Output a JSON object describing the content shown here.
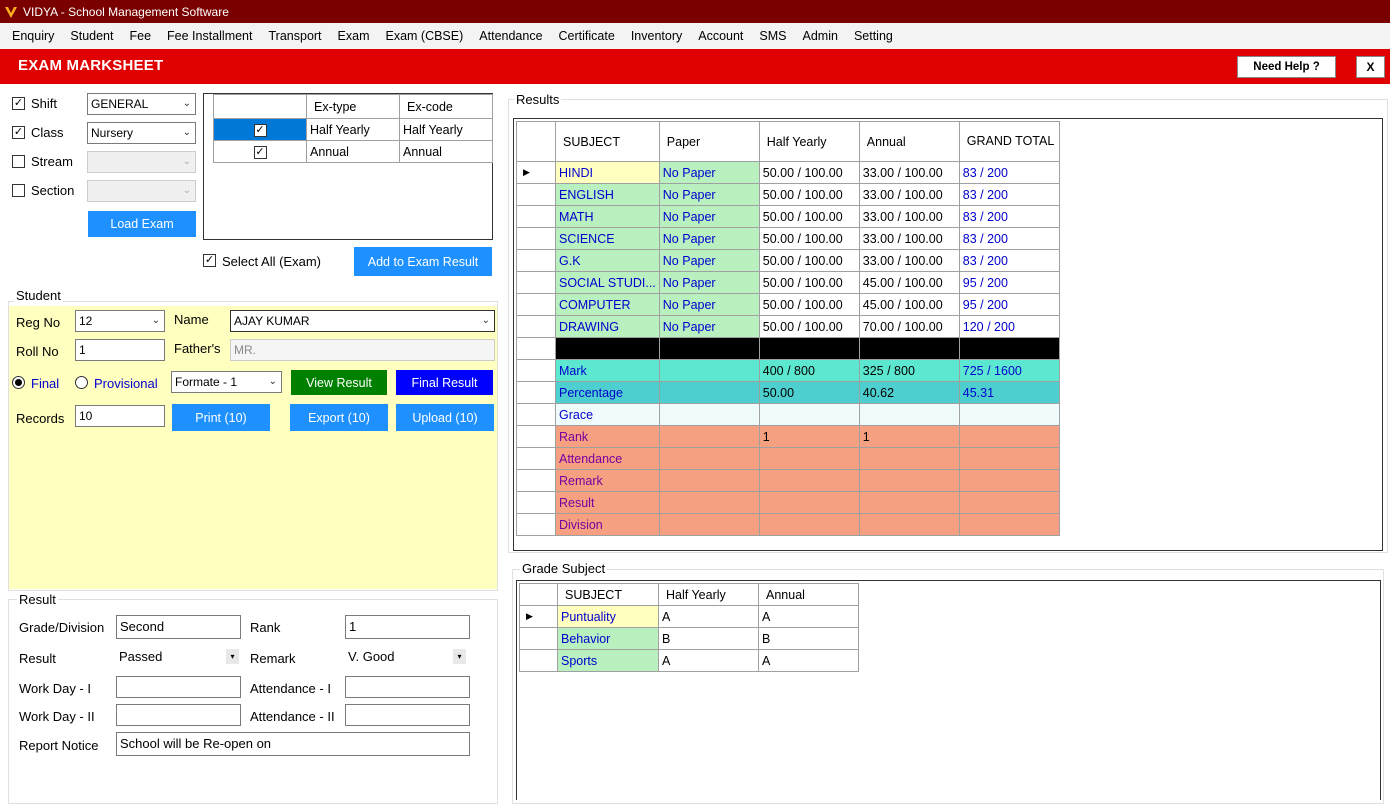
{
  "app": {
    "title": "VIDYA - School Management Software"
  },
  "menu": [
    "Enquiry",
    "Student",
    "Fee",
    "Fee Installment",
    "Transport",
    "Exam",
    "Exam (CBSE)",
    "Attendance",
    "Certificate",
    "Inventory",
    "Account",
    "SMS",
    "Admin",
    "Setting"
  ],
  "header": {
    "title": "EXAM MARKSHEET",
    "help_label": "Need Help ?",
    "close_label": "X"
  },
  "filters": {
    "shift": {
      "label": "Shift",
      "checked": true,
      "value": "GENERAL"
    },
    "class": {
      "label": "Class",
      "checked": true,
      "value": "Nursery"
    },
    "stream": {
      "label": "Stream",
      "checked": false,
      "value": ""
    },
    "section": {
      "label": "Section",
      "checked": false,
      "value": ""
    },
    "load_exam_label": "Load Exam"
  },
  "exam_grid": {
    "headers": [
      "Ex-type",
      "Ex-code"
    ],
    "rows": [
      {
        "checked": true,
        "type": "Half Yearly",
        "code": "Half Yearly",
        "selected": true
      },
      {
        "checked": true,
        "type": "Annual",
        "code": "Annual",
        "selected": false
      }
    ]
  },
  "select_all_label": "Select All (Exam)",
  "add_result_label": "Add to Exam Result",
  "student": {
    "title": "Student",
    "reg_no_label": "Reg No",
    "reg_no": "12",
    "name_label": "Name",
    "name": "AJAY KUMAR",
    "roll_no_label": "Roll No",
    "roll_no": "1",
    "father_label": "Father's",
    "father": "MR.",
    "final_label": "Final",
    "provisional_label": "Provisional",
    "format": "Formate - 1",
    "view_result_label": "View Result",
    "final_result_label": "Final Result",
    "records_label": "Records",
    "records": "10",
    "print_label": "Print (10)",
    "export_label": "Export (10)",
    "upload_label": "Upload (10)"
  },
  "result": {
    "title": "Result",
    "grade_label": "Grade/Division",
    "grade": "Second",
    "rank_label": "Rank",
    "rank": "1",
    "result_label": "Result",
    "result": "Passed",
    "remark_label": "Remark",
    "remark": "V. Good",
    "workday1_label": "Work Day - I",
    "workday1": "",
    "att1_label": "Attendance - I",
    "att1": "",
    "workday2_label": "Work Day - II",
    "workday2": "",
    "att2_label": "Attendance - II",
    "att2": "",
    "notice_label": "Report Notice",
    "notice": "School will be Re-open on"
  },
  "results": {
    "title": "Results",
    "headers": [
      "SUBJECT",
      "Paper",
      "Half Yearly",
      "Annual",
      "GRAND TOTAL"
    ],
    "subjects": [
      {
        "subject": "HINDI",
        "paper": "No Paper",
        "hy": "50.00 / 100.00",
        "an": "33.00 / 100.00",
        "total": "83 / 200"
      },
      {
        "subject": "ENGLISH",
        "paper": "No Paper",
        "hy": "50.00 / 100.00",
        "an": "33.00 / 100.00",
        "total": "83 / 200"
      },
      {
        "subject": "MATH",
        "paper": "No Paper",
        "hy": "50.00 / 100.00",
        "an": "33.00 / 100.00",
        "total": "83 / 200"
      },
      {
        "subject": "SCIENCE",
        "paper": "No Paper",
        "hy": "50.00 / 100.00",
        "an": "33.00 / 100.00",
        "total": "83 / 200"
      },
      {
        "subject": "G.K",
        "paper": "No Paper",
        "hy": "50.00 / 100.00",
        "an": "33.00 / 100.00",
        "total": "83 / 200"
      },
      {
        "subject": "SOCIAL STUDI...",
        "paper": "No Paper",
        "hy": "50.00 / 100.00",
        "an": "45.00 / 100.00",
        "total": "95 / 200"
      },
      {
        "subject": "COMPUTER",
        "paper": "No Paper",
        "hy": "50.00 / 100.00",
        "an": "45.00 / 100.00",
        "total": "95 / 200"
      },
      {
        "subject": "DRAWING",
        "paper": "No Paper",
        "hy": "50.00 / 100.00",
        "an": "70.00 / 100.00",
        "total": "120 / 200"
      }
    ],
    "mark": {
      "label": "Mark",
      "hy": "400 / 800",
      "an": "325 / 800",
      "total": "725 / 1600"
    },
    "percentage": {
      "label": "Percentage",
      "hy": "50.00",
      "an": "40.62",
      "total": "45.31"
    },
    "grace": {
      "label": "Grace"
    },
    "rank": {
      "label": "Rank",
      "hy": "1",
      "an": "1"
    },
    "attendance": {
      "label": "Attendance"
    },
    "remark": {
      "label": "Remark"
    },
    "result": {
      "label": "Result"
    },
    "division": {
      "label": "Division"
    }
  },
  "grade_subject": {
    "title": "Grade Subject",
    "headers": [
      "SUBJECT",
      "Half Yearly",
      "Annual"
    ],
    "rows": [
      {
        "subject": "Puntuality",
        "hy": "A",
        "an": "A"
      },
      {
        "subject": "Behavior",
        "hy": "B",
        "an": "B"
      },
      {
        "subject": "Sports",
        "hy": "A",
        "an": "A"
      }
    ]
  },
  "colors": {
    "titlebar": "#7a0000",
    "header": "#e00000",
    "subject_bg": "#b8f0c0",
    "mark_bg": "#5ce8d0",
    "percent_bg": "#4dcfcf",
    "orange_bg": "#f5a080",
    "accent_blue": "#1e90ff"
  }
}
